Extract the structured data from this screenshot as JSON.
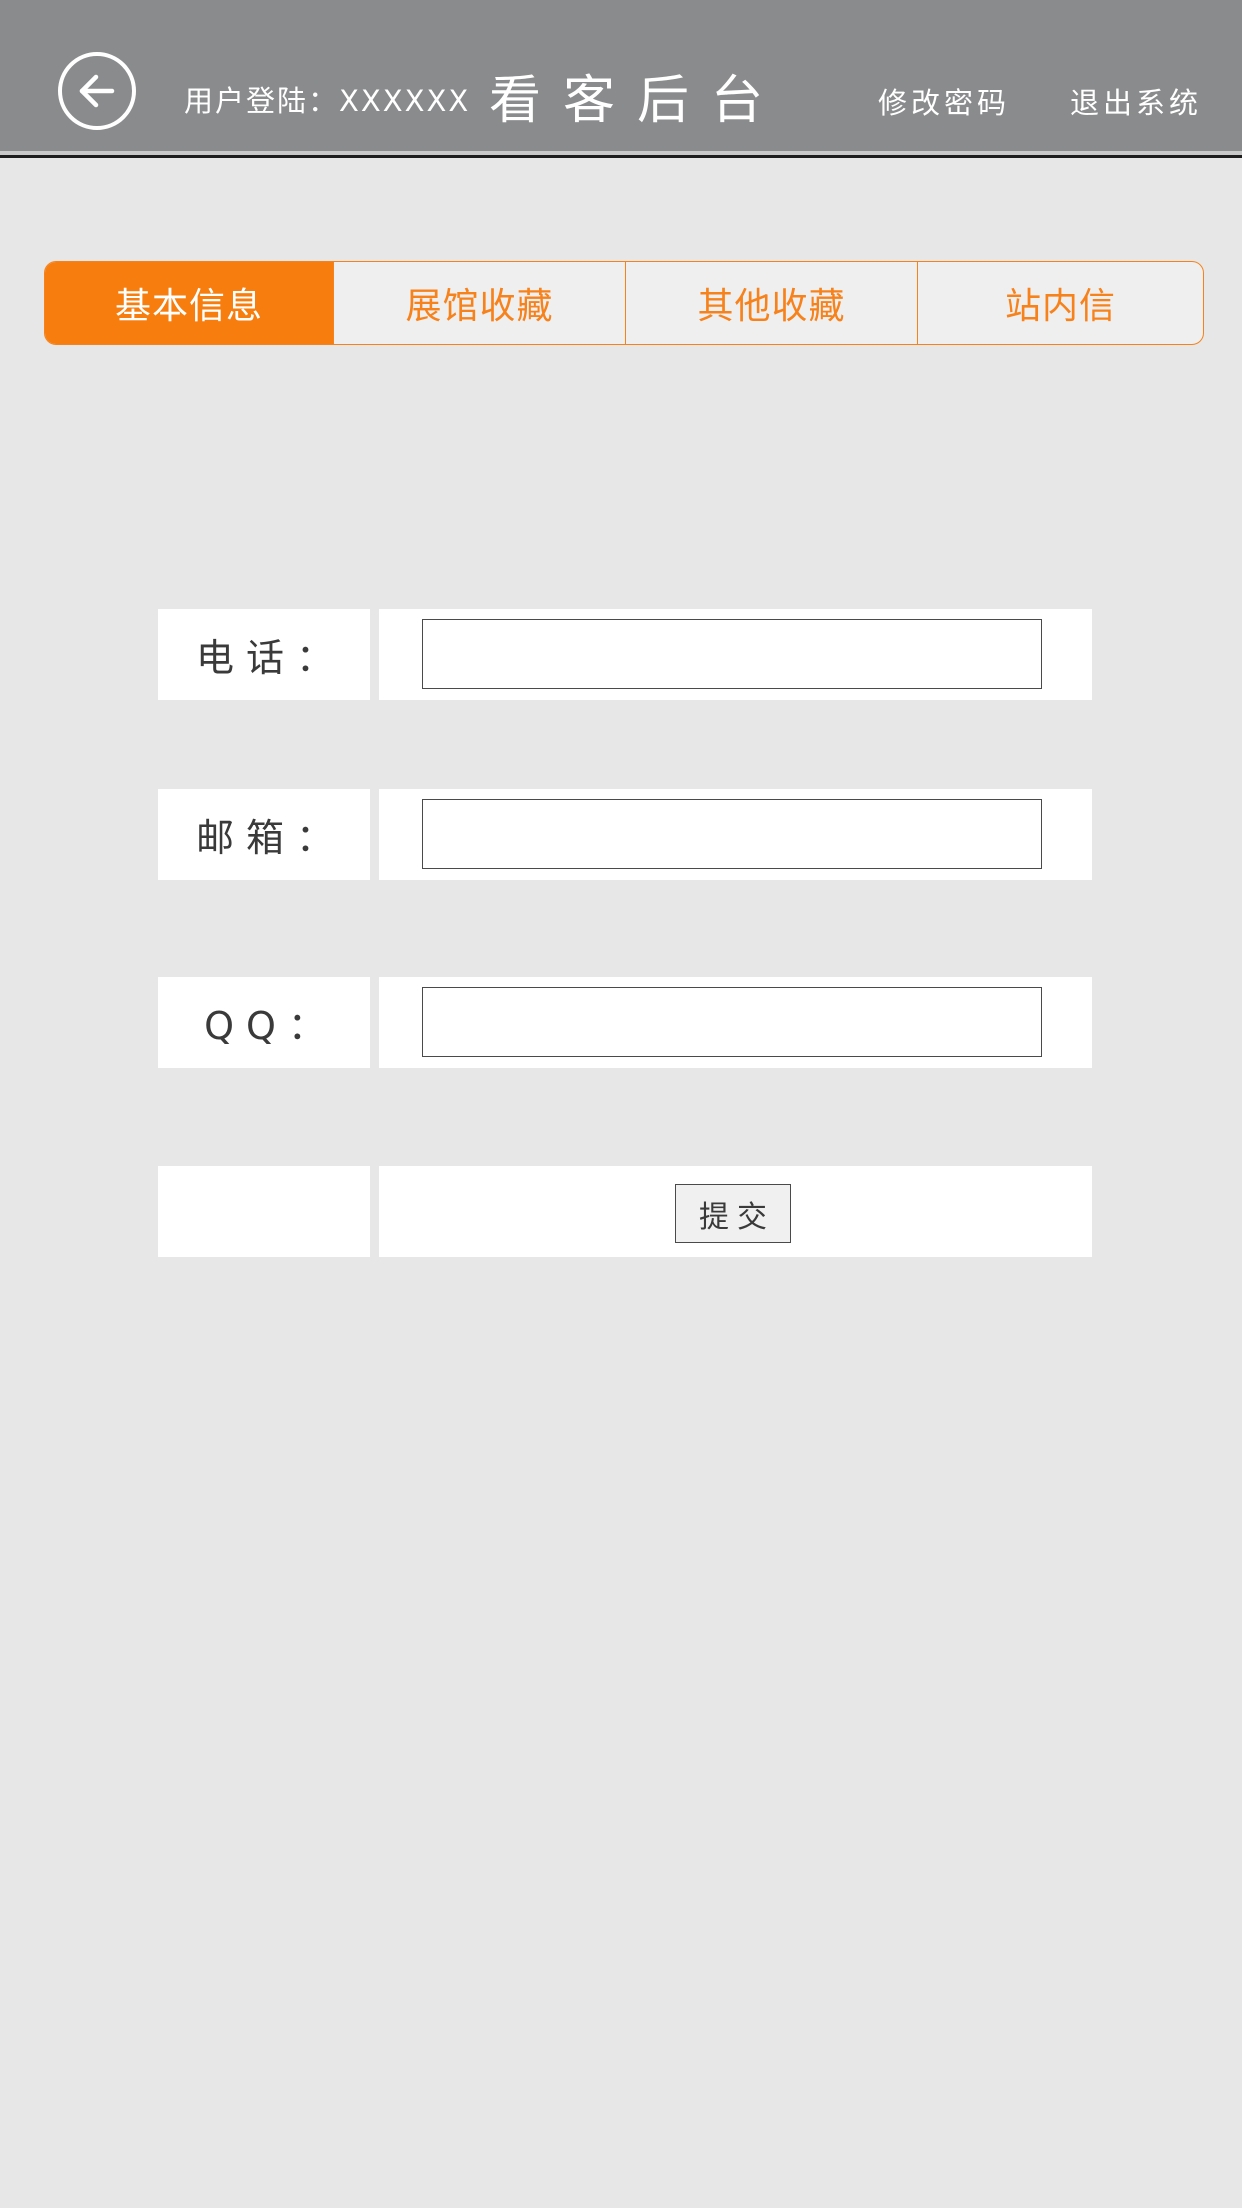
{
  "header": {
    "back_icon": "arrow-left-circle-icon",
    "user_login_text": "用户登陆：XXXXXX",
    "title": "看客后台",
    "change_password": "修改密码",
    "logout": "退出系统"
  },
  "tabs": [
    {
      "label": "基本信息",
      "active": true
    },
    {
      "label": "展馆收藏",
      "active": false
    },
    {
      "label": "其他收藏",
      "active": false
    },
    {
      "label": "站内信",
      "active": false
    }
  ],
  "form": {
    "phone": {
      "label": "电话：",
      "value": ""
    },
    "email": {
      "label": "邮箱：",
      "value": ""
    },
    "qq": {
      "label": "QQ：",
      "value": ""
    },
    "submit_label": "提交"
  },
  "colors": {
    "header_bg": "#8a8b8d",
    "accent": "#f67d0e",
    "page_bg": "#e7e7e7"
  }
}
